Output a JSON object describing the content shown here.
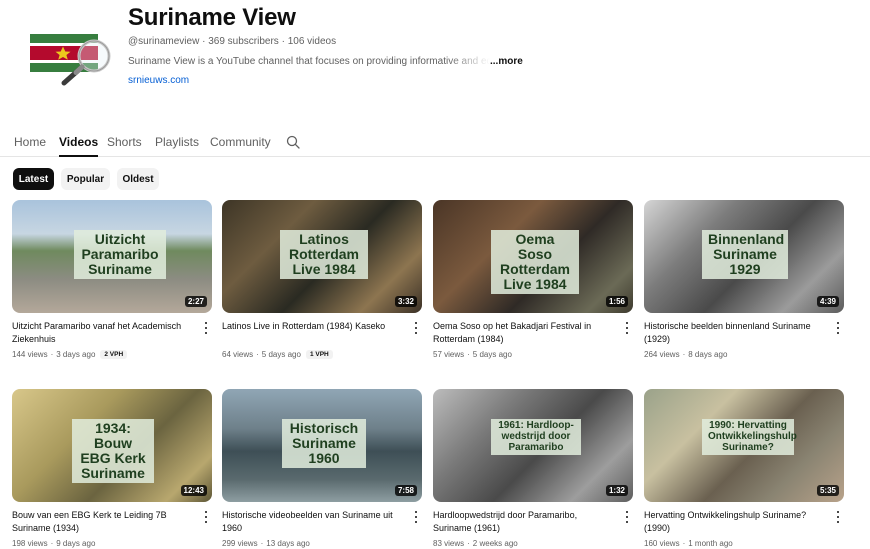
{
  "channel": {
    "name": "Suriname View",
    "handle": "@surinameview",
    "subscribers": "369 subscribers",
    "video_count": "106 videos",
    "meta_sep": "·",
    "description": "Suriname View is a YouTube channel that focuses on providing informative and education",
    "more_label": "...more",
    "link": "srnieuws.com",
    "avatar_icon": "suriname-flag-magnifier"
  },
  "tabs": [
    {
      "label": "Home",
      "active": false
    },
    {
      "label": "Videos",
      "active": true
    },
    {
      "label": "Shorts",
      "active": false
    },
    {
      "label": "Playlists",
      "active": false
    },
    {
      "label": "Community",
      "active": false
    }
  ],
  "chips": [
    {
      "label": "Latest",
      "active": true
    },
    {
      "label": "Popular",
      "active": false
    },
    {
      "label": "Oldest",
      "active": false
    }
  ],
  "videos": [
    {
      "title": "Uitzicht Paramaribo vanaf het Academisch Ziekenhuis",
      "overlay": "Uitzicht\nParamaribo\nSuriname",
      "duration": "2:27",
      "views": "144 views",
      "age": "3 days ago",
      "badge": "2 VPH",
      "progress": 0.0
    },
    {
      "title": "Latinos Live in Rotterdam (1984) Kaseko",
      "overlay": "Latinos\nRotterdam\nLive 1984",
      "duration": "3:32",
      "views": "64 views",
      "age": "5 days ago",
      "badge": "1 VPH",
      "progress": 0.0
    },
    {
      "title": "Oema Soso op het Bakadjari Festival in Rotterdam (1984)",
      "overlay": "Oema Soso\nRotterdam\nLive 1984",
      "duration": "1:56",
      "views": "57 views",
      "age": "5 days ago",
      "badge": "",
      "progress": 0.0
    },
    {
      "title": "Historische beelden binnenland Suriname (1929)",
      "overlay": "Binnenland\nSuriname\n1929",
      "duration": "4:39",
      "views": "264 views",
      "age": "8 days ago",
      "badge": "",
      "progress": 0.0
    },
    {
      "title": "Bouw van een EBG Kerk te Leiding 7B Suriname (1934)",
      "overlay": "1934: Bouw\nEBG Kerk\nSuriname",
      "duration": "12:43",
      "views": "198 views",
      "age": "9 days ago",
      "badge": "",
      "progress": 0.0
    },
    {
      "title": "Historische videobeelden van Suriname uit 1960",
      "overlay": "Historisch\nSuriname\n1960",
      "duration": "7:58",
      "views": "299 views",
      "age": "13 days ago",
      "badge": "",
      "progress": 0.0
    },
    {
      "title": "Hardloopwedstrijd door Paramaribo, Suriname (1961)",
      "overlay": "1961: Hardloop-\nwedstrijd door\nParamaribo",
      "duration": "1:32",
      "views": "83 views",
      "age": "2 weeks ago",
      "badge": "",
      "progress": 0.0
    },
    {
      "title": "Hervatting Ontwikkelingshulp Suriname? (1990)",
      "overlay": "1990: Hervatting\nOntwikkelingshulp\nSuriname?",
      "duration": "5:35",
      "views": "160 views",
      "age": "1 month ago",
      "badge": "",
      "progress": 0.0
    }
  ],
  "colors": {
    "accent": "#ff0033",
    "flag_green": "#377e3f",
    "flag_red": "#b40a2d",
    "flag_yellow": "#ecc81d",
    "link": "#065fd4"
  }
}
